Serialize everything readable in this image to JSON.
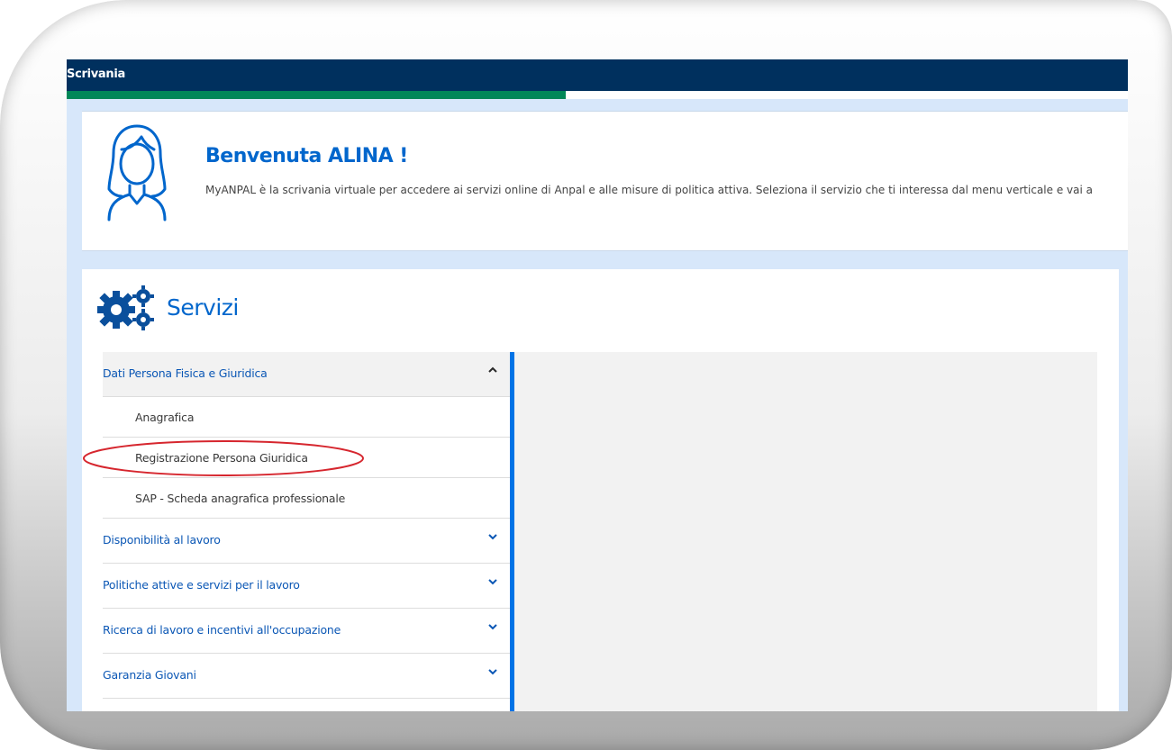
{
  "topbar": {
    "title": "Scrivania",
    "progress_percent": 47
  },
  "welcome": {
    "title": "Benvenuta ALINA !",
    "text": "MyANPAL è la scrivania virtuale per accedere ai servizi online di Anpal e alle misure di politica attiva. Seleziona il servizio che ti interessa dal menu verticale e vai a"
  },
  "services": {
    "title": "Servizi",
    "menu": [
      {
        "label": "Dati Persona Fisica e Giuridica",
        "expanded": true,
        "icon": "chevron-up-icon",
        "subitems": [
          "Anagrafica",
          "Registrazione Persona Giuridica",
          "SAP - Scheda anagrafica professionale"
        ]
      },
      {
        "label": "Disponibilità al lavoro",
        "expanded": false,
        "icon": "chevron-down-icon"
      },
      {
        "label": "Politiche attive e servizi per il lavoro",
        "expanded": false,
        "icon": "chevron-down-icon"
      },
      {
        "label": "Ricerca di lavoro e incentivi all'occupazione",
        "expanded": false,
        "icon": "chevron-down-icon"
      },
      {
        "label": "Garanzia Giovani",
        "expanded": false,
        "icon": "chevron-down-icon"
      }
    ]
  },
  "colors": {
    "header": "#00305e",
    "accent_green": "#008758",
    "link_blue": "#0066cc",
    "menu_border": "#0073e6",
    "annotation": "#d6262e"
  }
}
